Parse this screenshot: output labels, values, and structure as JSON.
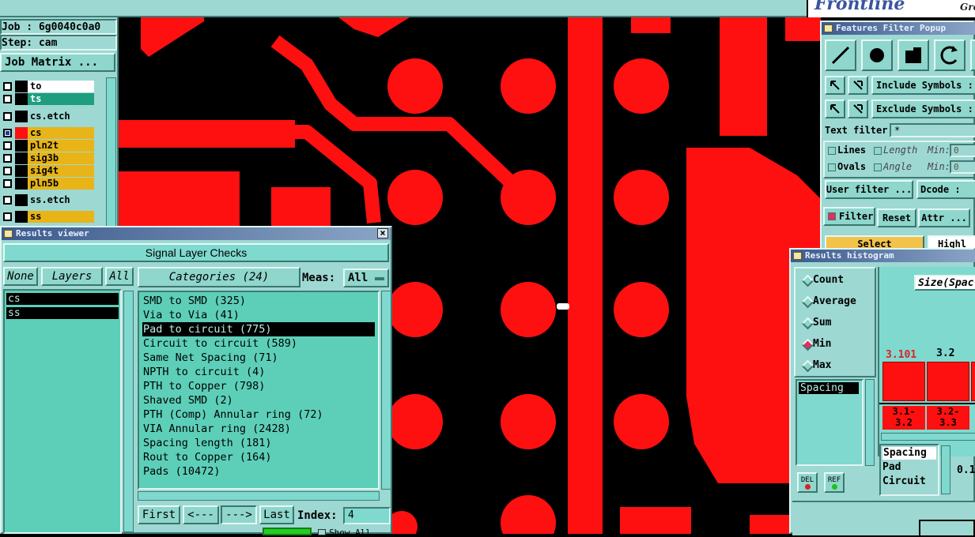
{
  "job": {
    "job_label": "Job : 6g0040c0a0",
    "step_label": "Step: cam",
    "matrix_button": "Job Matrix ..."
  },
  "brand": {
    "logo_text": "Frontline",
    "logo_sub": "Gro"
  },
  "layers": [
    {
      "name": "to",
      "color": "#ffffff",
      "checked": false
    },
    {
      "name": "ts",
      "color": "#1e9e7e",
      "checked": false
    },
    {
      "name": "cs.etch",
      "color": "#9ed8d2",
      "checked": false
    },
    {
      "name": "cs",
      "color": "#e8b417",
      "checked": true
    },
    {
      "name": "pln2t",
      "color": "#e8b417",
      "checked": false
    },
    {
      "name": "sig3b",
      "color": "#e8b417",
      "checked": false
    },
    {
      "name": "sig4t",
      "color": "#e8b417",
      "checked": false
    },
    {
      "name": "pln5b",
      "color": "#e8b417",
      "checked": false
    },
    {
      "name": "ss.etch",
      "color": "#9ed8d2",
      "checked": false
    },
    {
      "name": "ss",
      "color": "#e8b417",
      "checked": false
    }
  ],
  "results_viewer": {
    "title": "Results viewer",
    "header": "Signal Layer Checks",
    "none_button": "None",
    "layers_label": "Layers",
    "all_button": "All",
    "categories_label": "Categories (24)",
    "meas_label": "Meas:",
    "meas_value": "All",
    "layer_list": [
      "cs",
      "ss"
    ],
    "categories": [
      "SMD to SMD (325)",
      "Via to Via (41)",
      "Pad to circuit (775)",
      "Circuit to circuit (589)",
      "Same Net Spacing (71)",
      "NPTH to circuit (4)",
      "PTH to Copper (798)",
      "Shaved SMD (2)",
      "PTH (Comp) Annular ring (72)",
      "VIA Annular ring (2428)",
      "Spacing length (181)",
      "Rout to Copper (164)",
      "Pads (10472)"
    ],
    "selected_category": 2,
    "first_button": "First",
    "prev_button": "<---",
    "next_button": "--->",
    "last_button": "Last",
    "index_label": "Index:",
    "index_value": "4",
    "show_all_label": "Show All"
  },
  "features_filter": {
    "title": "Features Filter Popup",
    "include_symbols": "Include Symbols :",
    "exclude_symbols": "Exclude Symbols :",
    "text_filter_label": "Text filter",
    "text_filter_value": "*",
    "lines_label": "Lines",
    "ovals_label": "Ovals",
    "length_label": "Length",
    "angle_label": "Angle",
    "min_label": "Min:",
    "min_value_1": "0",
    "min_value_2": "0",
    "user_filter_button": "User filter ...",
    "dcode_button": "Dcode :",
    "filter_label": "Filter",
    "reset_button": "Reset",
    "attr_button": "Attr ...",
    "select_button": "Select",
    "highlight_button": "Highl"
  },
  "histogram": {
    "title": "Results histogram",
    "modes": [
      "Count",
      "Average",
      "Sum",
      "Min",
      "Max"
    ],
    "selected_mode": "Min",
    "measure_list": [
      "Spacing"
    ],
    "del_label": "DEL",
    "ref_label": "REF",
    "axis_dropdown": "Size(Spac",
    "bar_values": [
      "3.101",
      "3.2"
    ],
    "bar_ranges": [
      "3.1-\n3.2",
      "3.2-\n3.3"
    ],
    "info_lines": [
      "Spacing",
      "Pad",
      "Circuit"
    ],
    "side_value": "0.1"
  },
  "colors": {
    "board": "#000000",
    "copper": "#ff1010",
    "panel": "#9ed8d2",
    "accent_title": "#3c5a8c",
    "highlight_yellow": "#e8b417"
  }
}
